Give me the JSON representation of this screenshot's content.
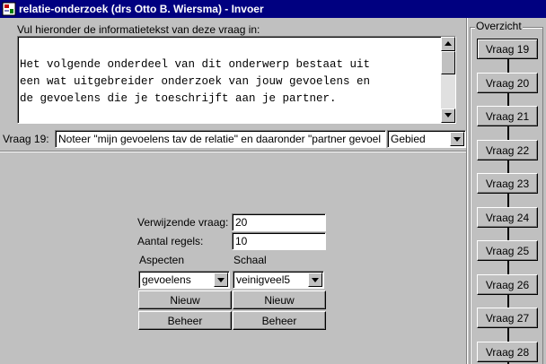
{
  "window": {
    "title": "relatie-onderzoek (drs Otto B. Wiersma) - Invoer"
  },
  "info": {
    "label": "Vul hieronder de informatietekst van deze vraag in:",
    "text": "\nHet volgende onderdeel van dit onderwerp bestaat uit\neen wat uitgebreider onderzoek van jouw gevoelens en\nde gevoelens die je toeschrijft aan je partner.\n\nNoteer hieronder op twee regels:"
  },
  "question": {
    "label": "Vraag 19:",
    "value": "Noteer \"mijn gevoelens tav de relatie\" en daaronder \"partner gevoel",
    "type_selected": "Gebied"
  },
  "form": {
    "ref_label": "Verwijzende vraag:",
    "ref_value": "20",
    "lines_label": "Aantal regels:",
    "lines_value": "10",
    "aspects_label": "Aspecten",
    "scale_label": "Schaal",
    "aspects_selected": "gevoelens",
    "scale_selected": "veinigveel5",
    "new_label": "Nieuw",
    "manage_label": "Beheer"
  },
  "overview": {
    "title": "Overzicht",
    "items": [
      {
        "label": "Vraag 19"
      },
      {
        "label": "Vraag 20"
      },
      {
        "label": "Vraag 21"
      },
      {
        "label": "Vraag 22"
      },
      {
        "label": "Vraag 23"
      },
      {
        "label": "Vraag 24"
      },
      {
        "label": "Vraag 25"
      },
      {
        "label": "Vraag 26"
      },
      {
        "label": "Vraag 27"
      },
      {
        "label": "Vraag 28"
      }
    ]
  },
  "icons": {
    "app": "app-icon",
    "scroll_up": "arrow-up-icon",
    "scroll_down": "arrow-down-icon",
    "dropdown": "chevron-down-icon"
  },
  "colors": {
    "titlebar": "#000080",
    "face": "#c0c0c0"
  }
}
